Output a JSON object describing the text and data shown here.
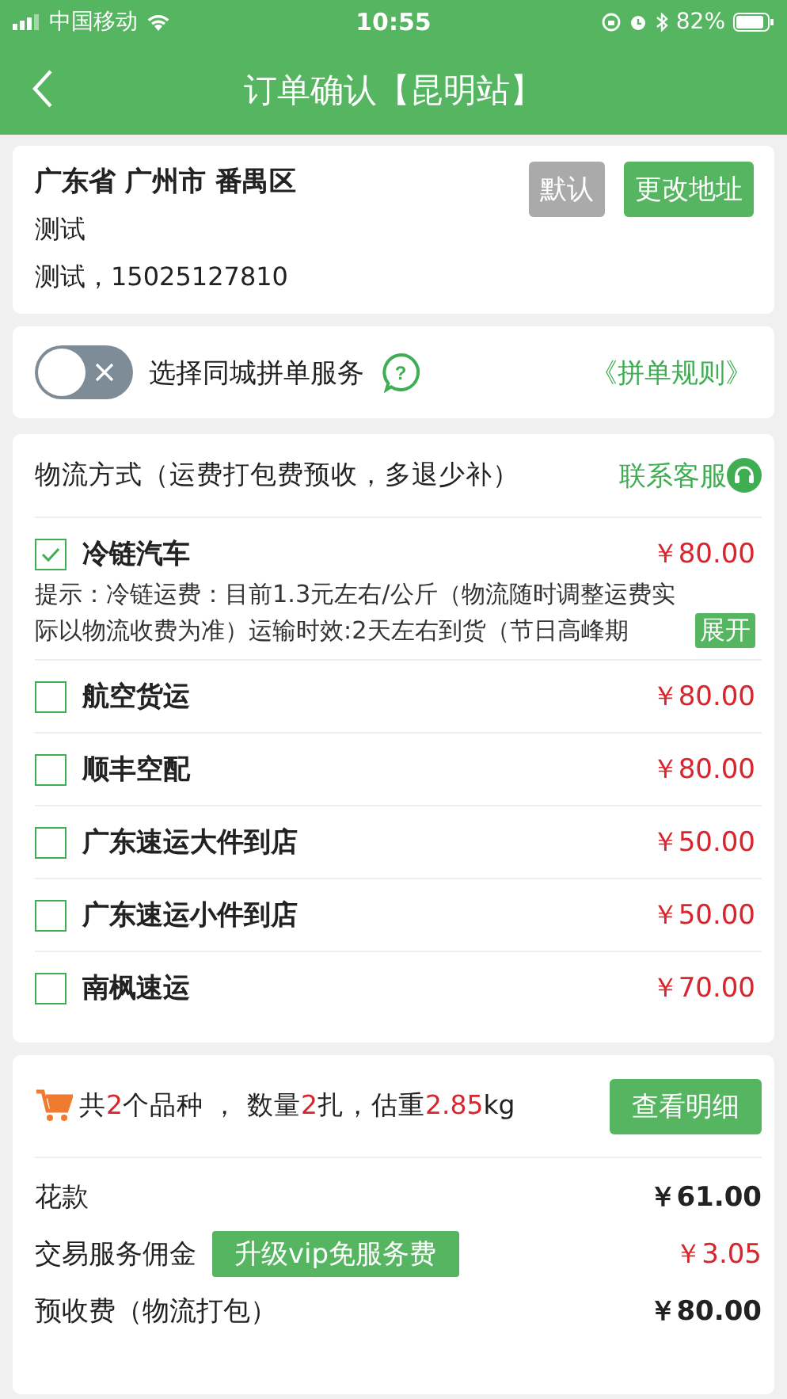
{
  "status_bar": {
    "carrier": "中国移动",
    "time": "10:55",
    "battery": "82%"
  },
  "nav": {
    "title": "订单确认【昆明站】"
  },
  "address": {
    "region": "广东省 广州市 番禺区",
    "name": "测试",
    "contact": "测试，15025127810",
    "default_label": "默认",
    "change_label": "更改地址"
  },
  "group_service": {
    "on": false,
    "label": "选择同城拼单服务",
    "help_glyph": "?",
    "rules_link": "《拼单规则》"
  },
  "logistics": {
    "title": "物流方式（运费打包费预收，多退少补）",
    "contact_link": "联系客服",
    "options": [
      {
        "name": "冷链汽车",
        "price": "￥80.00",
        "selected": true,
        "hint": "提示：冷链运费：目前1.3元左右/公斤（物流随时调整运费实际以物流收费为准）运输时效:2天左右到货（节日高峰期",
        "expand_label": "展开"
      },
      {
        "name": "航空货运",
        "price": "￥80.00",
        "selected": false
      },
      {
        "name": "顺丰空配",
        "price": "￥80.00",
        "selected": false
      },
      {
        "name": "广东速运大件到店",
        "price": "￥50.00",
        "selected": false
      },
      {
        "name": "广东速运小件到店",
        "price": "￥50.00",
        "selected": false
      },
      {
        "name": "南枫速运",
        "price": "￥70.00",
        "selected": false
      }
    ]
  },
  "summary": {
    "parts": [
      {
        "text": "共",
        "highlight": false
      },
      {
        "text": "2",
        "highlight": true
      },
      {
        "text": "个品种 ， 数量",
        "highlight": false
      },
      {
        "text": "2",
        "highlight": true
      },
      {
        "text": "扎，估重",
        "highlight": false
      },
      {
        "text": "2.85",
        "highlight": true
      },
      {
        "text": "kg",
        "highlight": false
      }
    ],
    "detail_button": "查看明细"
  },
  "fees": [
    {
      "label": "花款",
      "amount": "￥61.00",
      "kind": "bold"
    },
    {
      "label": "交易服务佣金",
      "amount": "￥3.05",
      "kind": "red",
      "badge": "升级vip免服务费"
    },
    {
      "label": "预收费（物流打包）",
      "amount": "￥80.00",
      "kind": "bold"
    }
  ]
}
